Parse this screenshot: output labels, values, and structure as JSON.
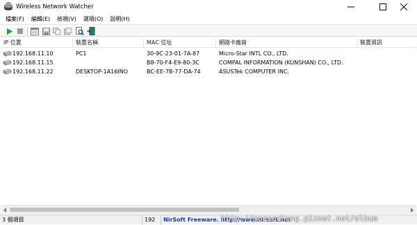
{
  "window": {
    "title": "Wireless Network Watcher",
    "app_icon": "network-watcher-icon"
  },
  "menu": {
    "items": [
      {
        "label": "檔案(F)"
      },
      {
        "label": "編輯(E)"
      },
      {
        "label": "檢視(V)"
      },
      {
        "label": "選項(O)"
      },
      {
        "label": "說明(H)"
      }
    ]
  },
  "toolbar": {
    "buttons": [
      {
        "icon": "play-icon"
      },
      {
        "icon": "stop-icon"
      },
      {
        "icon": "properties-icon"
      },
      {
        "icon": "save-icon"
      },
      {
        "icon": "copy-icon"
      },
      {
        "icon": "html-report-icon"
      },
      {
        "icon": "find-icon"
      },
      {
        "icon": "exit-icon"
      }
    ]
  },
  "table": {
    "columns": [
      "IP 位置",
      "裝置名稱",
      "MAC 位址",
      "網路卡廠商",
      "裝置資訊"
    ],
    "rows": [
      {
        "ip": "192.168.11.10",
        "name": "PC1",
        "mac": "30-9C-23-01-7A-87",
        "vendor": "Micro-Star INTL CO., LTD.",
        "info": ""
      },
      {
        "ip": "192.168.11.15",
        "name": "",
        "mac": "B8-70-F4-E9-80-3C",
        "vendor": "COMPAL INFORMATION (KUNSHAN) CO., LTD.",
        "info": ""
      },
      {
        "ip": "192.168.11.22",
        "name": "DESKTOP-1A16INO",
        "mac": "BC-EE-7B-77-DA-74",
        "vendor": "ASUSTek COMPUTER INC.",
        "info": ""
      }
    ]
  },
  "status": {
    "count": "3 個項目",
    "middle": "192",
    "credit": "NirSoft Freeware.  http://www.nirsoft.net"
  },
  "watermark": {
    "text": "http://morsecheng.pixnet.net/album"
  },
  "colors": {
    "play": "#1aa32a",
    "credit_link": "#1a3aa8"
  }
}
